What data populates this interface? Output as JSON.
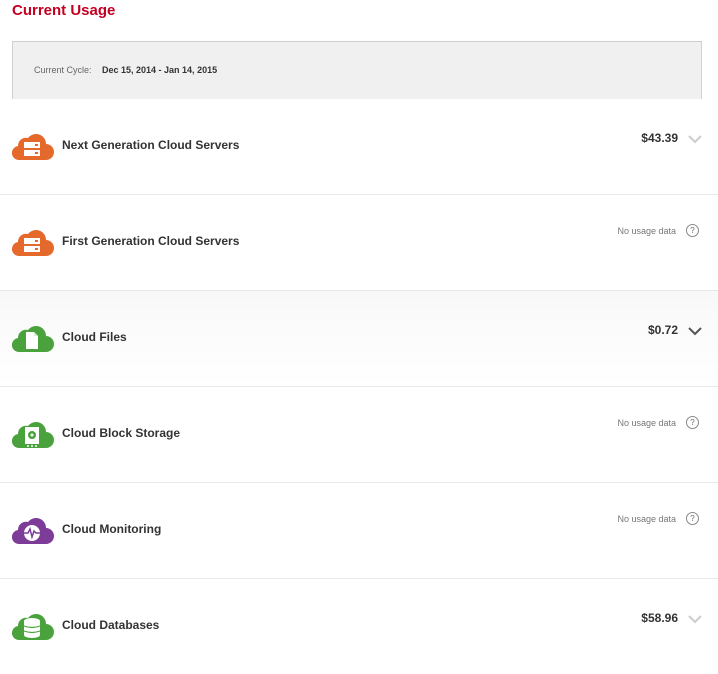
{
  "page": {
    "title": "Current Usage"
  },
  "cycle": {
    "label": "Current Cycle:",
    "value": "Dec 15, 2014 - Jan 14, 2015"
  },
  "colors": {
    "orange": "#e4692a",
    "green": "#4aa23c",
    "purple": "#7d3c98",
    "title_red": "#c40022"
  },
  "products": [
    {
      "name": "Next Generation Cloud Servers",
      "amount": "$43.39",
      "status": "",
      "icon": "server-cloud-icon",
      "color": "orange"
    },
    {
      "name": "First Generation Cloud Servers",
      "amount": "",
      "status": "No usage data",
      "icon": "server-cloud-icon",
      "color": "orange"
    },
    {
      "name": "Cloud Files",
      "amount": "$0.72",
      "status": "",
      "icon": "file-cloud-icon",
      "color": "green"
    },
    {
      "name": "Cloud Block Storage",
      "amount": "",
      "status": "No usage data",
      "icon": "disk-cloud-icon",
      "color": "green"
    },
    {
      "name": "Cloud Monitoring",
      "amount": "",
      "status": "No usage data",
      "icon": "monitor-cloud-icon",
      "color": "purple"
    },
    {
      "name": "Cloud Databases",
      "amount": "$58.96",
      "status": "",
      "icon": "database-cloud-icon",
      "color": "green"
    }
  ],
  "help_glyph": "?"
}
